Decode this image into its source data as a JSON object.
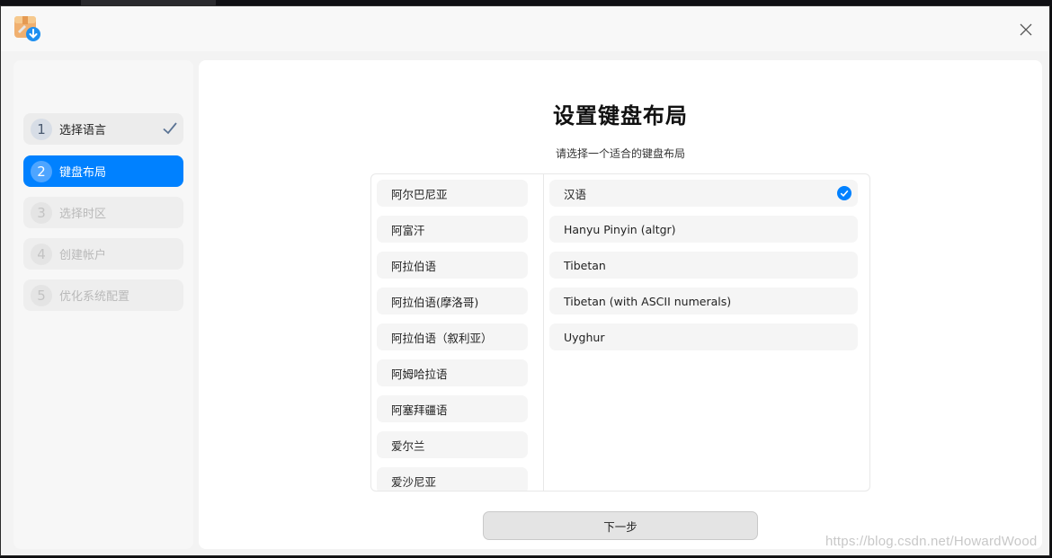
{
  "sidebar": {
    "steps": [
      {
        "num": "1",
        "label": "选择语言",
        "state": "done"
      },
      {
        "num": "2",
        "label": "键盘布局",
        "state": "active"
      },
      {
        "num": "3",
        "label": "选择时区",
        "state": "todo"
      },
      {
        "num": "4",
        "label": "创建帐户",
        "state": "todo"
      },
      {
        "num": "5",
        "label": "优化系统配置",
        "state": "todo"
      }
    ]
  },
  "main": {
    "title": "设置键盘布局",
    "subtitle": "请选择一个适合的键盘布局",
    "languages": [
      "阿尔巴尼亚",
      "阿富汗",
      "阿拉伯语",
      "阿拉伯语(摩洛哥)",
      "阿拉伯语（叙利亚）",
      "阿姆哈拉语",
      "阿塞拜疆语",
      "爱尔兰",
      "爱沙尼亚"
    ],
    "variants": [
      {
        "label": "汉语",
        "selected": true
      },
      {
        "label": "Hanyu Pinyin (altgr)",
        "selected": false
      },
      {
        "label": "Tibetan",
        "selected": false
      },
      {
        "label": "Tibetan (with ASCII numerals)",
        "selected": false
      },
      {
        "label": "Uyghur",
        "selected": false
      }
    ],
    "next_label": "下一步"
  },
  "watermark": "https://blog.csdn.net/HowardWood",
  "icons": {
    "app": "installer-app-icon",
    "close": "close-icon",
    "step_done": "checkmark-icon",
    "selected": "check-circle-icon"
  },
  "colors": {
    "accent": "#0081ff"
  }
}
